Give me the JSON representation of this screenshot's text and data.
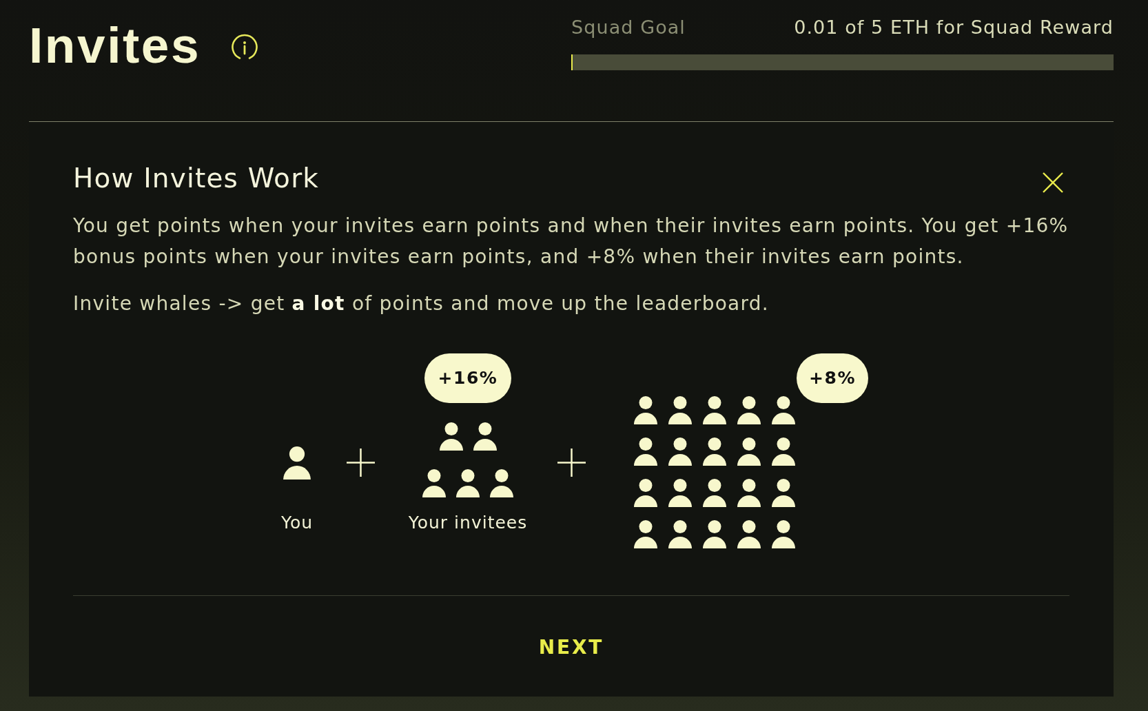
{
  "header": {
    "title": "Invites",
    "squad_goal": {
      "label": "Squad Goal",
      "progress_text": "0.01 of 5 ETH for Squad Reward",
      "level": 0.002
    }
  },
  "how_it_works_card": {
    "title": "How Invites Work",
    "paragraphs": [
      "You get points when your invites earn points and when their invites earn points. You get +16% bonus points when your invites earn points, and +8% when their invites earn points.",
      "Invite whales -> get **a lot** of points and move up the leaderboard."
    ],
    "diagram": {
      "groups": [
        {
          "kind": "single",
          "label": "You"
        },
        {
          "kind": "invitees",
          "label": "Your invitees",
          "badge": "+16%"
        },
        {
          "kind": "network",
          "badge": "+8%"
        }
      ]
    },
    "next_button": "NEXT"
  }
}
